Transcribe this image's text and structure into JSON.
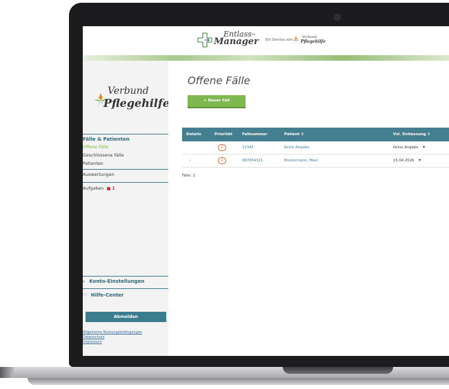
{
  "header": {
    "app_title_line1": "Entlass–",
    "app_title_line2": "Manager",
    "service_text": "Ein Service von:",
    "brand_line1": "Verbund",
    "brand_line2": "Pflegehilfe"
  },
  "sidebar": {
    "logo_line1": "Verbund",
    "logo_line2": "Pflegehilfe",
    "section_title": "Fälle & Patienten",
    "items": [
      {
        "label": "Offene Fälle",
        "active": true
      },
      {
        "label": "Geschlossene Fälle",
        "active": false
      },
      {
        "label": "Patienten",
        "active": false
      }
    ],
    "reports": "Auswertungen",
    "tasks": "Aufgaben",
    "tasks_badge": "1",
    "account": "Konto-Einstellungen",
    "account_chevron": "›",
    "help": "Hilfe-Center",
    "help_icon": "♡",
    "logout": "Abmelden",
    "links": [
      "Allgemeine Nutzungsbedingungen",
      "Datenschutz",
      "Impressum"
    ]
  },
  "main": {
    "title": "Offene Fälle",
    "new_case_button": "+ Neuer Fall",
    "table": {
      "columns": [
        "Details",
        "Priorität",
        "Fallnummer",
        "Patient ⇕",
        "Vsl. Entlassung ⇕"
      ],
      "rows": [
        {
          "details": "",
          "priority": "2",
          "case_number": "12345",
          "patient": "Keine Angabe",
          "discharge": "Keine Angabe"
        },
        {
          "details": "›",
          "priority": "1",
          "case_number": "987654321",
          "patient": "Mustermann, Maxi",
          "discharge": "15.04.2026"
        }
      ],
      "footer": "Fälle: 2"
    }
  },
  "colors": {
    "accent_teal": "#437f90",
    "accent_green": "#7eb84f",
    "priority_orange": "#d9632f",
    "alert_red": "#d9343a"
  }
}
